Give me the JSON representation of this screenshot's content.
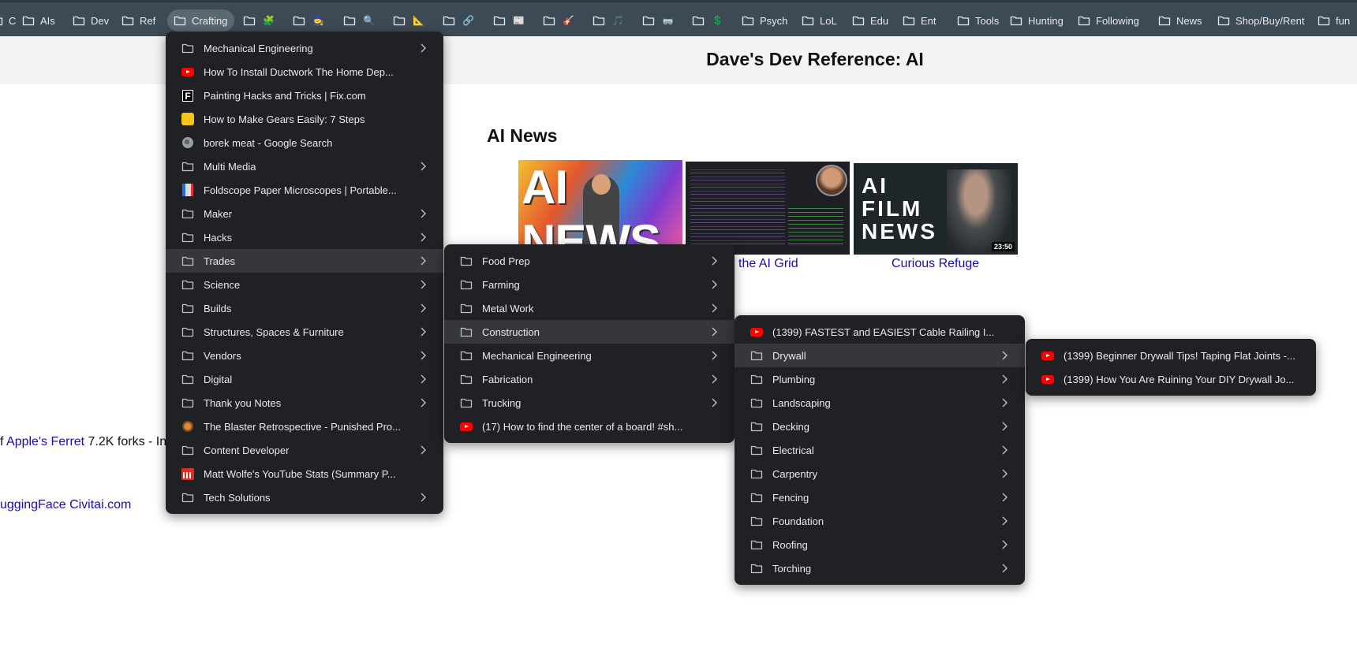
{
  "bookmarks_bar": {
    "items": [
      {
        "label": "C",
        "emoji": ""
      },
      {
        "label": "AIs",
        "emoji": ""
      },
      {
        "label": "Dev",
        "emoji": ""
      },
      {
        "label": "Ref",
        "emoji": ""
      },
      {
        "label": "Crafting",
        "emoji": ""
      },
      {
        "label": "",
        "emoji": "🧩"
      },
      {
        "label": "",
        "emoji": "🧙"
      },
      {
        "label": "",
        "emoji": "🔍"
      },
      {
        "label": "",
        "emoji": "📐"
      },
      {
        "label": "",
        "emoji": "🔗"
      },
      {
        "label": "",
        "emoji": "📰"
      },
      {
        "label": "",
        "emoji": "🎸"
      },
      {
        "label": "",
        "emoji": "🎵"
      },
      {
        "label": "",
        "emoji": "🥽"
      },
      {
        "label": "",
        "emoji": "💲"
      },
      {
        "label": "Psych",
        "emoji": ""
      },
      {
        "label": "LoL",
        "emoji": ""
      },
      {
        "label": "Edu",
        "emoji": ""
      },
      {
        "label": "Ent",
        "emoji": ""
      },
      {
        "label": "Tools",
        "emoji": ""
      },
      {
        "label": "Hunting",
        "emoji": ""
      },
      {
        "label": "Following",
        "emoji": ""
      },
      {
        "label": "News",
        "emoji": ""
      },
      {
        "label": "Shop/Buy/Rent",
        "emoji": ""
      },
      {
        "label": "fun",
        "emoji": ""
      }
    ]
  },
  "page": {
    "title": "Dave's Dev Reference: AI",
    "section_heading": "AI News",
    "thumb1_text": "AI NEWS",
    "thumb3_text": [
      "AI",
      "FILM",
      "NEWS"
    ],
    "thumb3_duration": "23:50",
    "caption2": "the AI Grid",
    "caption3": "Curious Refuge",
    "fragment1_prefix": "f ",
    "fragment1_link": "Apple's Ferret",
    "fragment1_suffix": " 7.2K forks - In",
    "fragment2": "uggingFace Civitai.com"
  },
  "menus": {
    "crafting": [
      {
        "label": "Mechanical Engineering",
        "icon": "folder",
        "submenu": true
      },
      {
        "label": "How To Install Ductwork The Home Dep...",
        "icon": "youtube",
        "submenu": false
      },
      {
        "label": "Painting Hacks and Tricks | Fix.com",
        "icon": "fixcom",
        "submenu": false
      },
      {
        "label": "How to Make Gears Easily: 7 Steps",
        "icon": "instructables",
        "submenu": false
      },
      {
        "label": "borek meat - Google Search",
        "icon": "globe",
        "submenu": false
      },
      {
        "label": "Multi Media",
        "icon": "folder",
        "submenu": true
      },
      {
        "label": "Foldscope Paper Microscopes | Portable...",
        "icon": "foldscope",
        "submenu": false
      },
      {
        "label": "Maker",
        "icon": "folder",
        "submenu": true
      },
      {
        "label": "Hacks",
        "icon": "folder",
        "submenu": true
      },
      {
        "label": "Trades",
        "icon": "folder",
        "submenu": true,
        "highlighted": true
      },
      {
        "label": "Science",
        "icon": "folder",
        "submenu": true
      },
      {
        "label": "Builds",
        "icon": "folder",
        "submenu": true
      },
      {
        "label": "Structures, Spaces & Furniture",
        "icon": "folder",
        "submenu": true
      },
      {
        "label": "Vendors",
        "icon": "folder",
        "submenu": true
      },
      {
        "label": "Digital",
        "icon": "folder",
        "submenu": true
      },
      {
        "label": "Thank you Notes",
        "icon": "folder",
        "submenu": true
      },
      {
        "label": "The Blaster Retrospective - Punished Pro...",
        "icon": "blaster",
        "submenu": false
      },
      {
        "label": "Content Developer",
        "icon": "folder",
        "submenu": true
      },
      {
        "label": "Matt Wolfe's YouTube Stats (Summary P...",
        "icon": "stats",
        "submenu": false
      },
      {
        "label": "Tech Solutions",
        "icon": "folder",
        "submenu": true
      }
    ],
    "trades": [
      {
        "label": "Food Prep",
        "icon": "folder",
        "submenu": true
      },
      {
        "label": "Farming",
        "icon": "folder",
        "submenu": true
      },
      {
        "label": "Metal Work",
        "icon": "folder",
        "submenu": true
      },
      {
        "label": "Construction",
        "icon": "folder",
        "submenu": true,
        "highlighted": true
      },
      {
        "label": "Mechanical Engineering",
        "icon": "folder",
        "submenu": true
      },
      {
        "label": "Fabrication",
        "icon": "folder",
        "submenu": true
      },
      {
        "label": "Trucking",
        "icon": "folder",
        "submenu": true
      },
      {
        "label": "(17) How to find the center of a board! #sh...",
        "icon": "youtube",
        "submenu": false
      }
    ],
    "construction": [
      {
        "label": "(1399) FASTEST and EASIEST Cable Railing I...",
        "icon": "youtube",
        "submenu": false
      },
      {
        "label": "Drywall",
        "icon": "folder",
        "submenu": true,
        "highlighted": true
      },
      {
        "label": "Plumbing",
        "icon": "folder",
        "submenu": true
      },
      {
        "label": "Landscaping",
        "icon": "folder",
        "submenu": true
      },
      {
        "label": "Decking",
        "icon": "folder",
        "submenu": true
      },
      {
        "label": "Electrical",
        "icon": "folder",
        "submenu": true
      },
      {
        "label": "Carpentry",
        "icon": "folder",
        "submenu": true
      },
      {
        "label": "Fencing",
        "icon": "folder",
        "submenu": true
      },
      {
        "label": "Foundation",
        "icon": "folder",
        "submenu": true
      },
      {
        "label": "Roofing",
        "icon": "folder",
        "submenu": true
      },
      {
        "label": "Torching",
        "icon": "folder",
        "submenu": true
      }
    ],
    "drywall": [
      {
        "label": "(1399) Beginner Drywall Tips! Taping Flat Joints -...",
        "icon": "youtube",
        "submenu": false
      },
      {
        "label": "(1399) How You Are Ruining Your DIY Drywall Jo...",
        "icon": "youtube",
        "submenu": false
      }
    ]
  },
  "colors": {
    "bookmarks_bar_bg": "#3c4a55",
    "menu_bg": "#202124",
    "menu_highlight": "#35373b",
    "link": "#1a0dab"
  }
}
